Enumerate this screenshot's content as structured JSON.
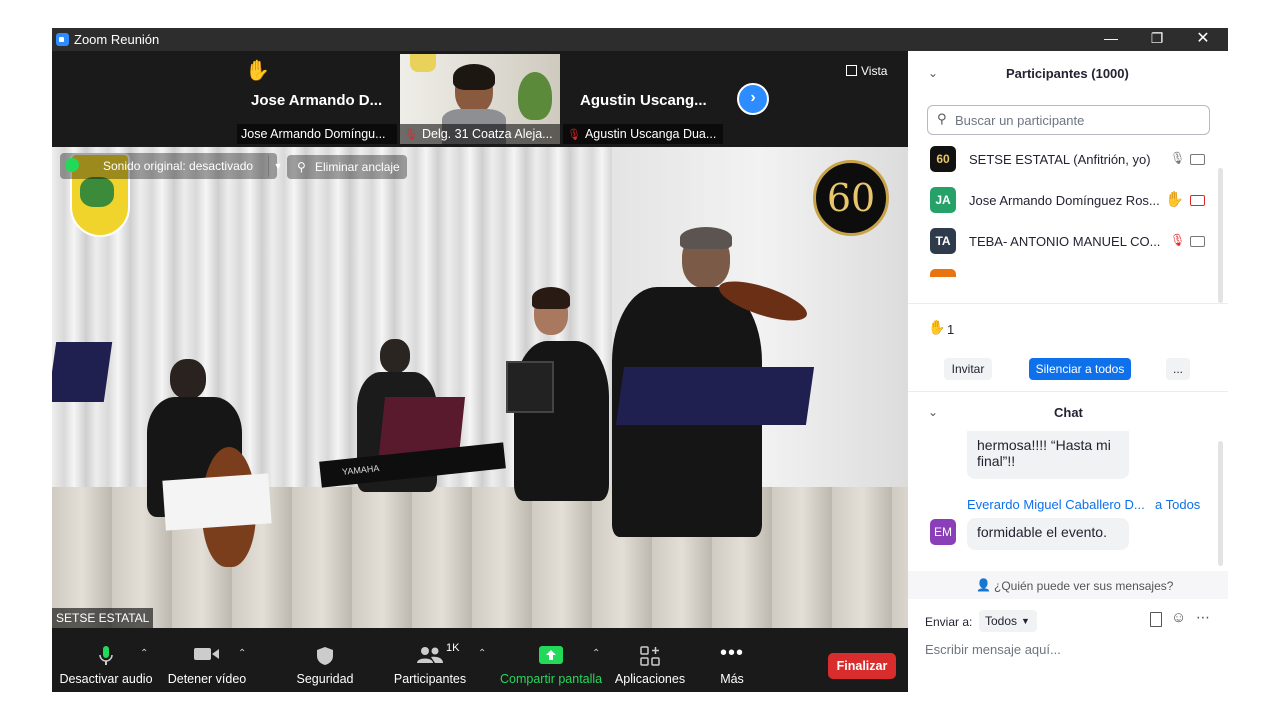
{
  "window": {
    "title": "Zoom Reunión",
    "min_icon": "minimize-icon",
    "restore_icon": "restore-icon",
    "close_icon": "close-icon"
  },
  "view_button": "Vista",
  "thumbnails": [
    {
      "big_name": "Jose Armando D...",
      "caption": "Jose Armando Domíngu...",
      "hand": true
    },
    {
      "big_name": "",
      "caption": "Delg. 31 Coatza Aleja...",
      "muted": true
    },
    {
      "big_name": "Agustin Uscang...",
      "caption": "Agustin Uscanga Dua...",
      "muted": true
    }
  ],
  "main_video": {
    "audio_notice": "Sonido original: desactivado",
    "unpin_label": "Eliminar anclaje",
    "speaker_label": "SETSE ESTATAL",
    "badge_number": "60",
    "keyboard_brand": "YAMAHA"
  },
  "toolbar": {
    "mute": "Desactivar audio",
    "video": "Detener vídeo",
    "security": "Seguridad",
    "participants": "Participantes",
    "participants_count": "1K",
    "share": "Compartir pantalla",
    "apps": "Aplicaciones",
    "more": "Más",
    "end": "Finalizar",
    "share_color": "#23d959",
    "end_color": "#d92d2d"
  },
  "participants_panel": {
    "title": "Participantes (1000)",
    "search_placeholder": "Buscar un participante",
    "items": [
      {
        "initials": "60",
        "name": "SETSE ESTATAL (Anfitrión, yo)",
        "color": "#1a1a1a"
      },
      {
        "initials": "JA",
        "name": "Jose Armando Domínguez Ros...",
        "color": "#26a269"
      },
      {
        "initials": "TA",
        "name": "TEBA- ANTONIO MANUEL CO...",
        "color": "#2d3b4a"
      }
    ],
    "raised_hands": "1",
    "invite": "Invitar",
    "mute_all": "Silenciar a todos",
    "more": "..."
  },
  "chat": {
    "title": "Chat",
    "msg1": "hermosa!!!! “Hasta mi final”!!",
    "sender": "Everardo Miguel Caballero D...",
    "to": "a Todos",
    "sender_initials": "EM",
    "msg2": "formidable el evento.",
    "privacy": "¿Quién puede ver sus mensajes?",
    "send_to_label": "Enviar a:",
    "send_to_value": "Todos",
    "input_placeholder": "Escribir mensaje aquí..."
  }
}
